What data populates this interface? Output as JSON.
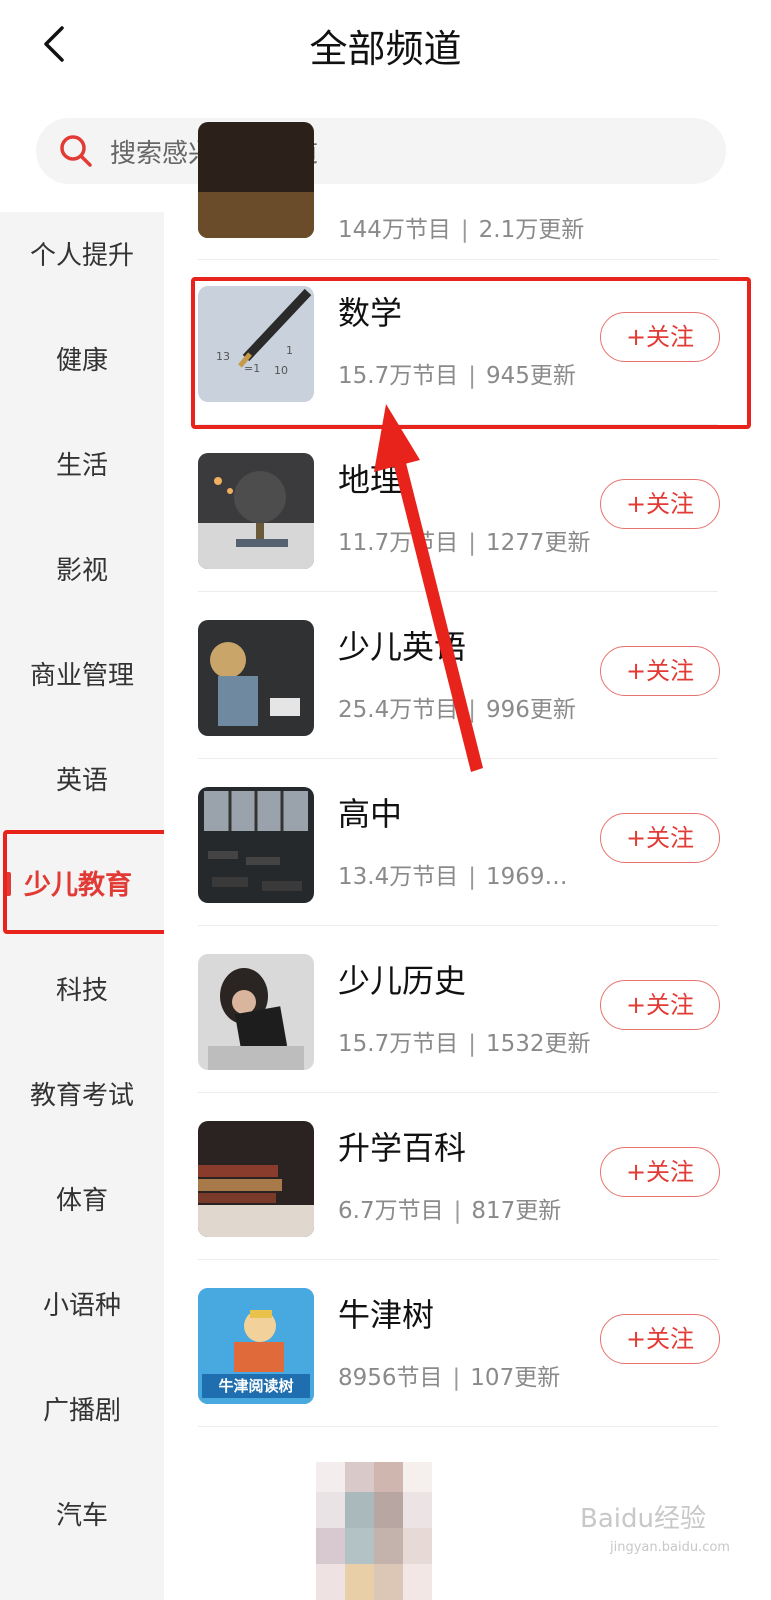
{
  "header": {
    "title": "全部频道",
    "back_icon": "chevron-left-icon"
  },
  "search": {
    "placeholder": "搜索感兴趣的频道",
    "icon": "search-icon"
  },
  "sidebar": {
    "items": [
      {
        "label": "个人提升"
      },
      {
        "label": "健康"
      },
      {
        "label": "生活"
      },
      {
        "label": "影视"
      },
      {
        "label": "商业管理"
      },
      {
        "label": "英语"
      },
      {
        "label": "少儿教育",
        "active": true
      },
      {
        "label": "科技"
      },
      {
        "label": "教育考试"
      },
      {
        "label": "体育"
      },
      {
        "label": "小语种"
      },
      {
        "label": "广播剧"
      },
      {
        "label": "汽车"
      }
    ]
  },
  "partial_row": {
    "meta_programs": "144万节目",
    "meta_updates": "2.1万更新"
  },
  "channels": [
    {
      "name": "数学",
      "programs": "15.7万节目",
      "updates": "945更新",
      "follow": "+关注"
    },
    {
      "name": "地理",
      "programs": "11.7万节目",
      "updates": "1277更新",
      "follow": "+关注"
    },
    {
      "name": "少儿英语",
      "programs": "25.4万节目",
      "updates": "996更新",
      "follow": "+关注"
    },
    {
      "name": "高中",
      "programs": "13.4万节目",
      "updates": "1969…",
      "follow": "+关注"
    },
    {
      "name": "少儿历史",
      "programs": "15.7万节目",
      "updates": "1532更新",
      "follow": "+关注"
    },
    {
      "name": "升学百科",
      "programs": "6.7万节目",
      "updates": "817更新",
      "follow": "+关注"
    },
    {
      "name": "牛津树",
      "programs": "8956节目",
      "updates": "107更新",
      "follow": "+关注",
      "thumb_text": "牛津阅读树"
    }
  ],
  "watermark": {
    "text": "Baidu经验",
    "sub": "jingyan.baidu.com"
  },
  "colors": {
    "accent": "#e23b35",
    "annotation": "#e8231c"
  }
}
